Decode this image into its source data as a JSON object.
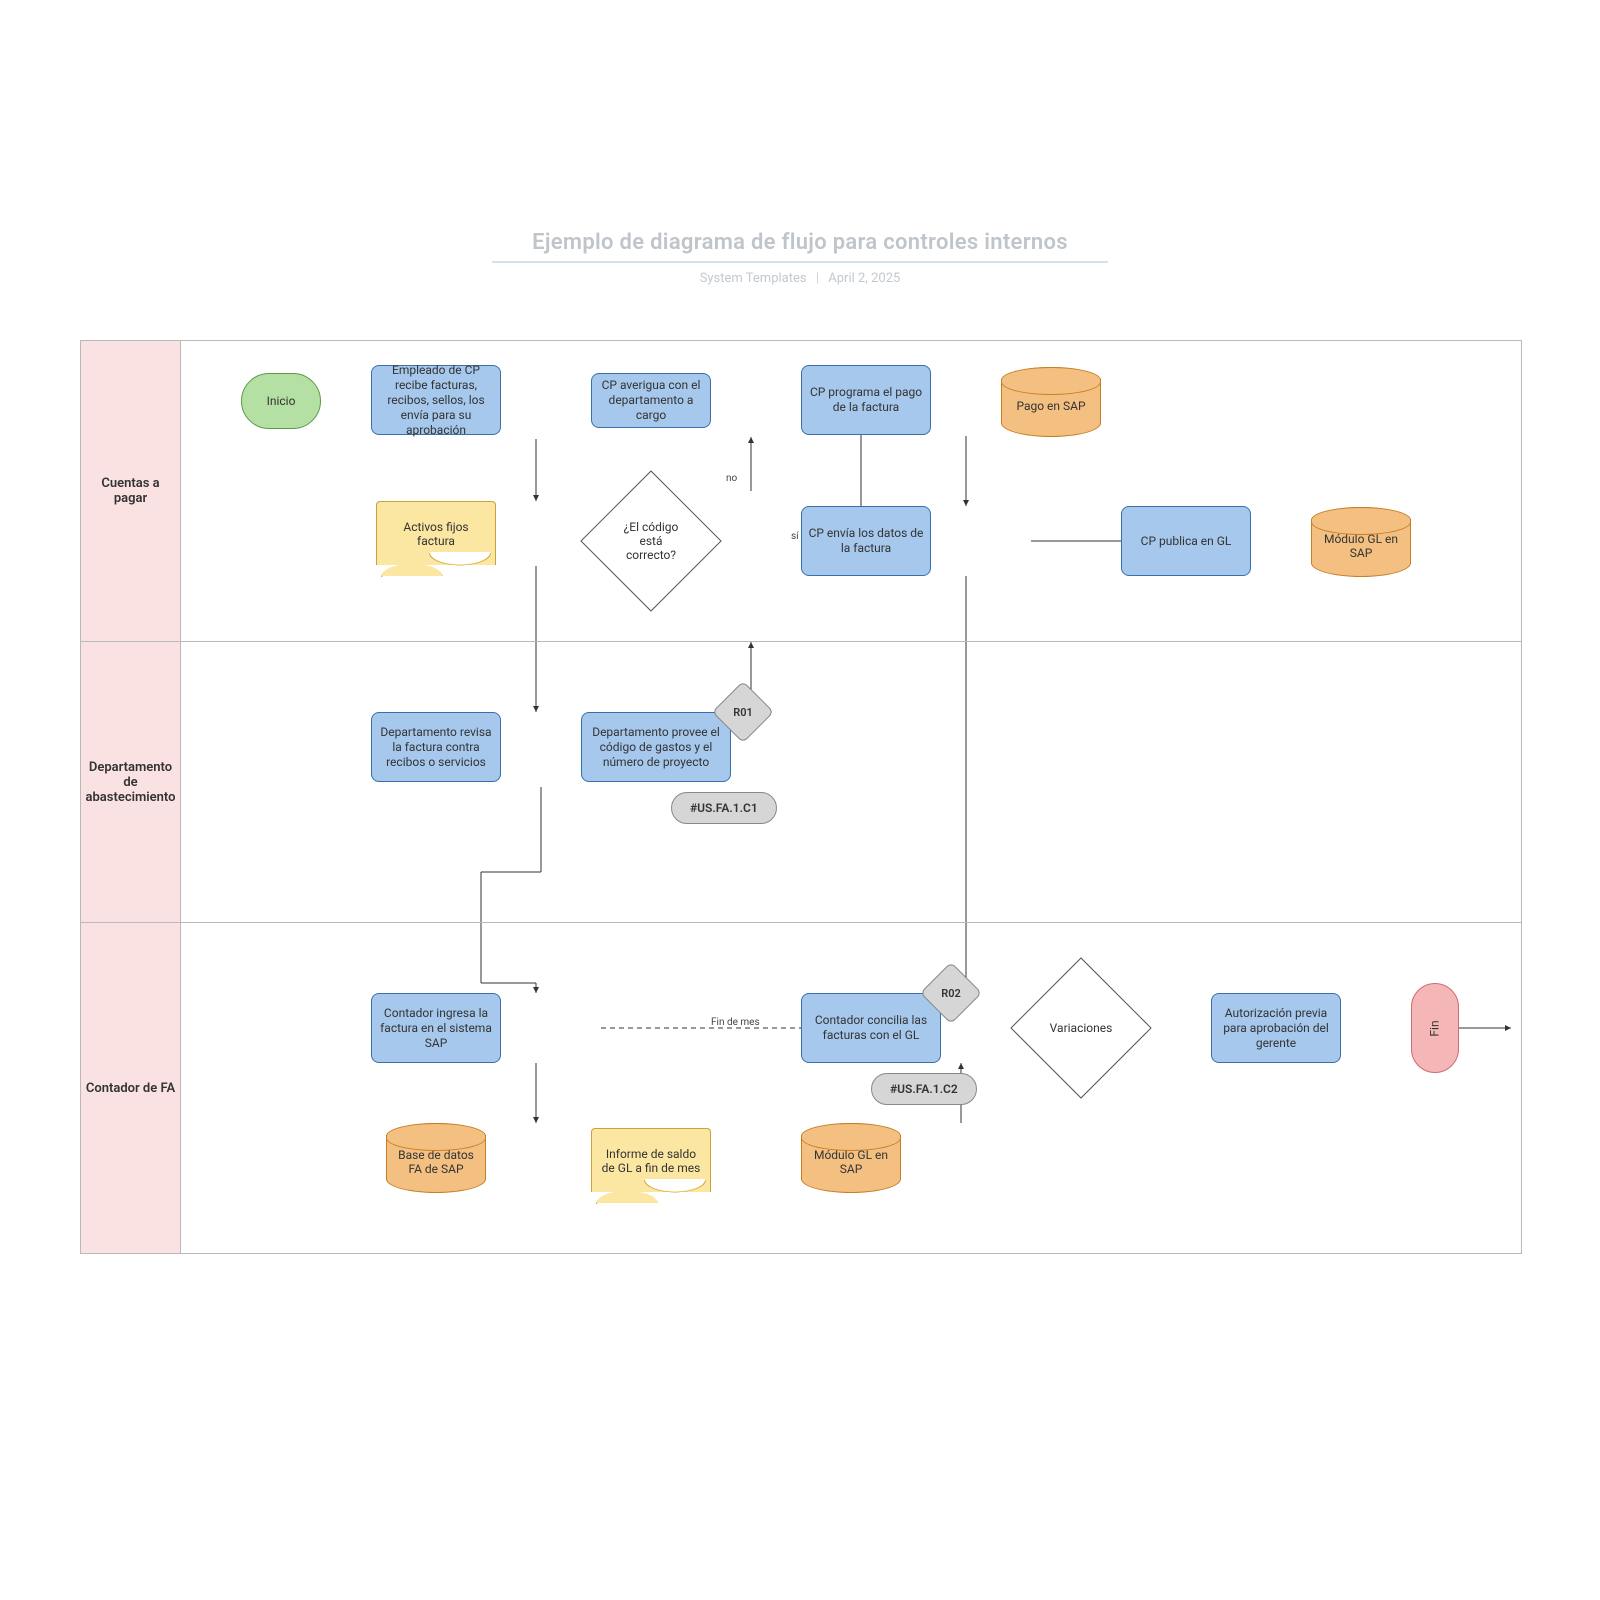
{
  "header": {
    "title": "Ejemplo de diagrama de flujo para controles internos",
    "author": "System Templates",
    "date": "April 2, 2025"
  },
  "lanes": {
    "ap": "Cuentas a pagar",
    "supply": "Departamento de abastecimiento",
    "fa": "Contador de FA"
  },
  "nodes": {
    "start": "Inicio",
    "n1": "Empleado de CP recibe facturas, recibos, sellos, los envía para su aprobación",
    "n2": "Activos fijos factura",
    "n3": "Departamento revisa la factura contra recibos o servicios",
    "n4": "Departamento provee el código de gastos y el número de proyecto",
    "d1": "¿El código está correcto?",
    "n5": "CP averigua con el departamento a cargo",
    "n6": "CP programa el pago de la factura",
    "n7": "CP envía los datos de la factura",
    "db1": "Pago en SAP",
    "n8": "CP publica en GL",
    "db2": "Módulo GL en SAP",
    "r01": "R01",
    "c1": "#US.FA.1.C1",
    "n9": "Contador ingresa la factura en el sistema SAP",
    "db3": "Base de datos FA de SAP",
    "n10": "Informe de saldo de GL a fin de mes",
    "db4": "Módulo GL en SAP",
    "n11": "Contador concilia las facturas con el GL",
    "r02": "R02",
    "c2": "#US.FA.1.C2",
    "d2": "Variaciones",
    "n12": "Autorización previa para aprobación del gerente",
    "end": "Fin",
    "mid": "Fin de mes"
  },
  "labels": {
    "no": "no",
    "si": "sí"
  }
}
